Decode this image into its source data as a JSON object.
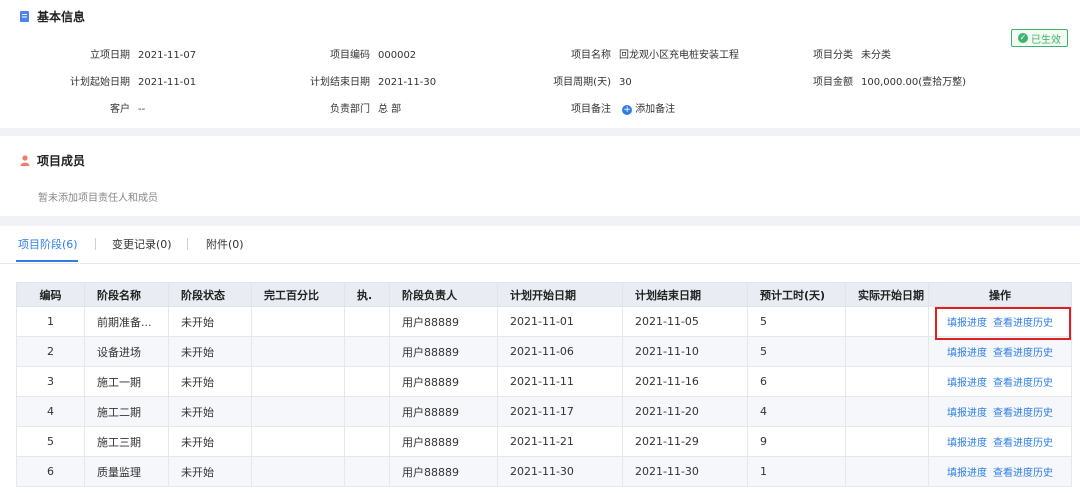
{
  "basic_info": {
    "title": "基本信息",
    "status_badge": "已生效",
    "fields": {
      "start_date_label": "立项日期",
      "start_date": "2021-11-07",
      "code_label": "项目编码",
      "code": "000002",
      "name_label": "项目名称",
      "name": "回龙观小区充电桩安装工程",
      "category_label": "项目分类",
      "category": "未分类",
      "plan_start_label": "计划起始日期",
      "plan_start": "2021-11-01",
      "plan_end_label": "计划结束日期",
      "plan_end": "2021-11-30",
      "period_label": "项目周期(天)",
      "period": "30",
      "amount_label": "项目金额",
      "amount": "100,000.00",
      "amount_words": "(壹拾万整)",
      "customer_label": "客户",
      "customer": "--",
      "dept_label": "负责部门",
      "dept": "总 部",
      "remark_label": "项目备注",
      "remark_link": "添加备注"
    }
  },
  "members": {
    "title": "项目成员",
    "empty_text": "暂未添加项目责任人和成员"
  },
  "tabs": [
    "项目阶段(6)",
    "变更记录(0)",
    "附件(0)"
  ],
  "table": {
    "headers": [
      "编码",
      "阶段名称",
      "阶段状态",
      "完工百分比",
      "执.",
      "阶段负责人",
      "计划开始日期",
      "计划结束日期",
      "预计工时(天)",
      "实际开始日期",
      "操作"
    ],
    "rows": [
      [
        "1",
        "前期准备...",
        "未开始",
        "",
        "",
        "用户88889",
        "2021-11-01",
        "2021-11-05",
        "5",
        ""
      ],
      [
        "2",
        "设备进场",
        "未开始",
        "",
        "",
        "用户88889",
        "2021-11-06",
        "2021-11-10",
        "5",
        ""
      ],
      [
        "3",
        "施工一期",
        "未开始",
        "",
        "",
        "用户88889",
        "2021-11-11",
        "2021-11-16",
        "6",
        ""
      ],
      [
        "4",
        "施工二期",
        "未开始",
        "",
        "",
        "用户88889",
        "2021-11-17",
        "2021-11-20",
        "4",
        ""
      ],
      [
        "5",
        "施工三期",
        "未开始",
        "",
        "",
        "用户88889",
        "2021-11-21",
        "2021-11-29",
        "9",
        ""
      ],
      [
        "6",
        "质量监理",
        "未开始",
        "",
        "",
        "用户88889",
        "2021-11-30",
        "2021-11-30",
        "1",
        ""
      ]
    ],
    "action_report": "填报进度",
    "action_history": "查看进度历史"
  },
  "colors": {
    "accent": "#2e7ee6",
    "success": "#3cb46b",
    "highlight": "#e02020",
    "icon_doc": "#4a84e8",
    "icon_person": "#f07b6b"
  },
  "icons": {
    "basic_info": "document-icon",
    "members": "person-icon",
    "status": "check-circle-icon",
    "add_remark": "plus-circle-icon"
  }
}
